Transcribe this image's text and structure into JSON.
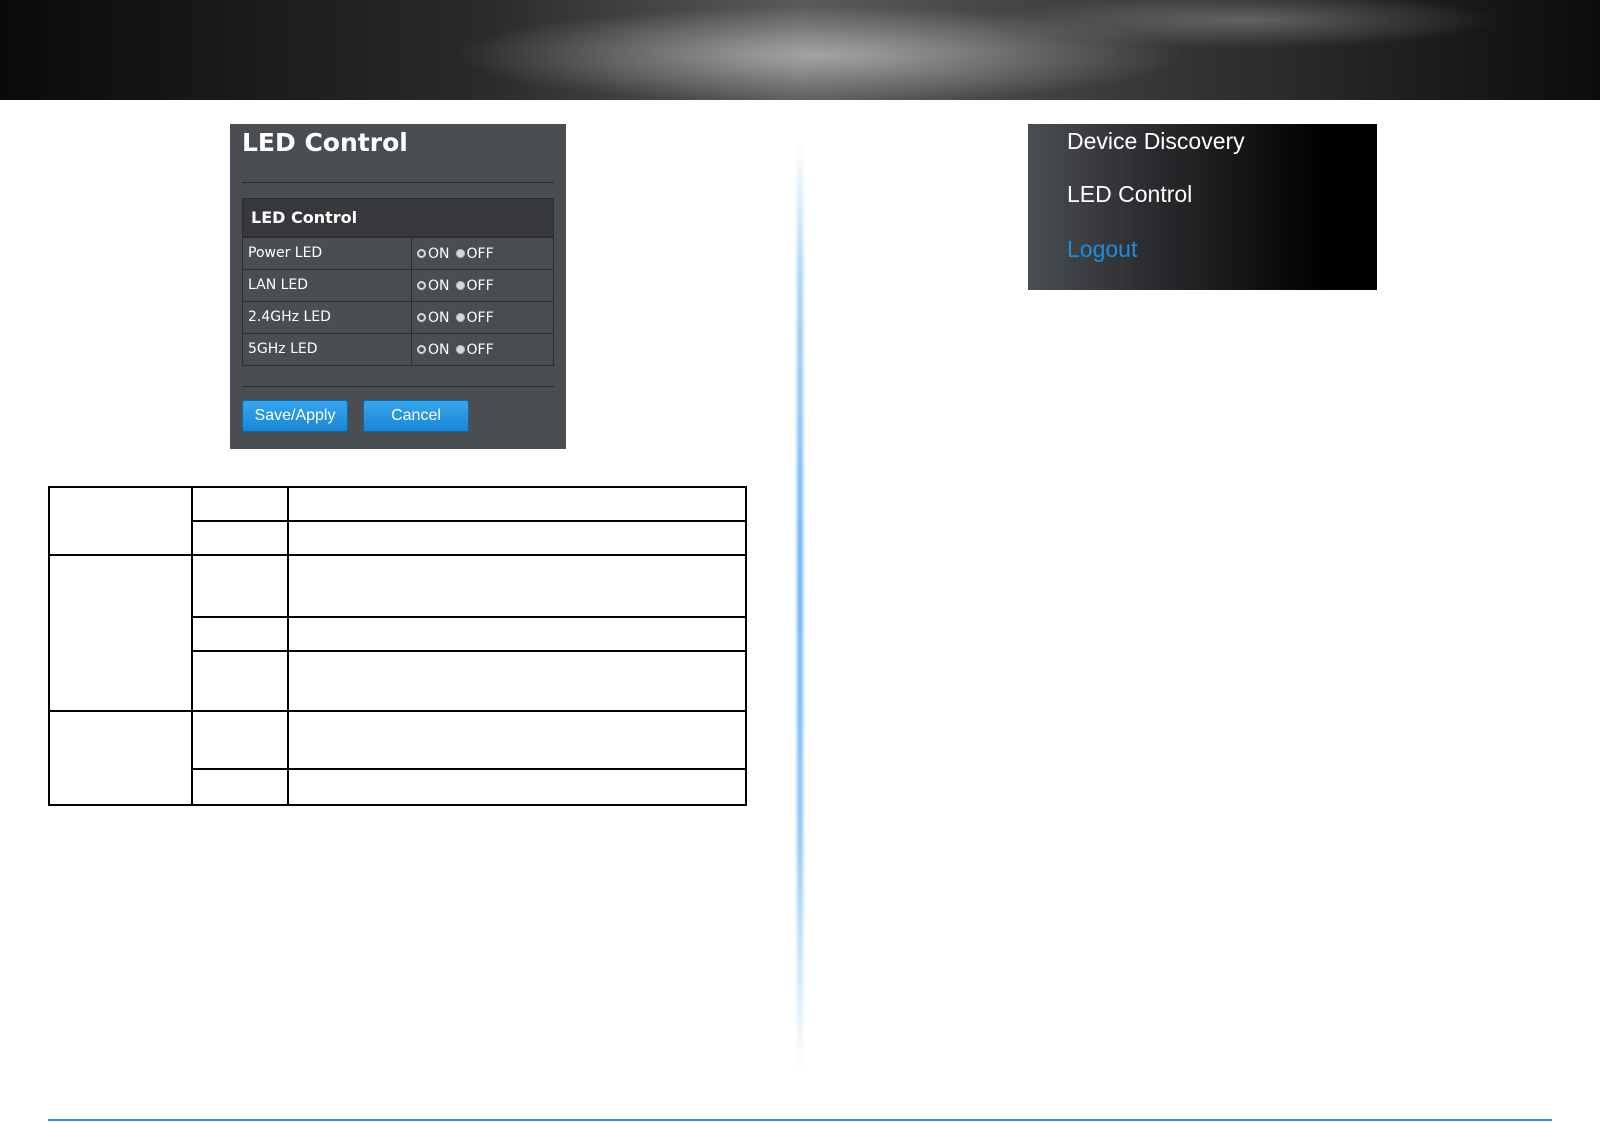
{
  "led_panel": {
    "title": "LED Control",
    "table_header": "LED Control",
    "rows": [
      {
        "label": "Power LED",
        "on": "ON",
        "off": "OFF"
      },
      {
        "label": "LAN LED",
        "on": "ON",
        "off": "OFF"
      },
      {
        "label": "2.4GHz LED",
        "on": "ON",
        "off": "OFF"
      },
      {
        "label": "5GHz LED",
        "on": "ON",
        "off": "OFF"
      }
    ],
    "save_label": "Save/Apply",
    "cancel_label": "Cancel"
  },
  "menu": {
    "items": [
      {
        "label": "Device Discovery"
      },
      {
        "label": "LED Control"
      },
      {
        "label": "Logout"
      }
    ]
  },
  "colors": {
    "accent": "#1a8fe0",
    "panel_bg": "#4a4d52"
  }
}
